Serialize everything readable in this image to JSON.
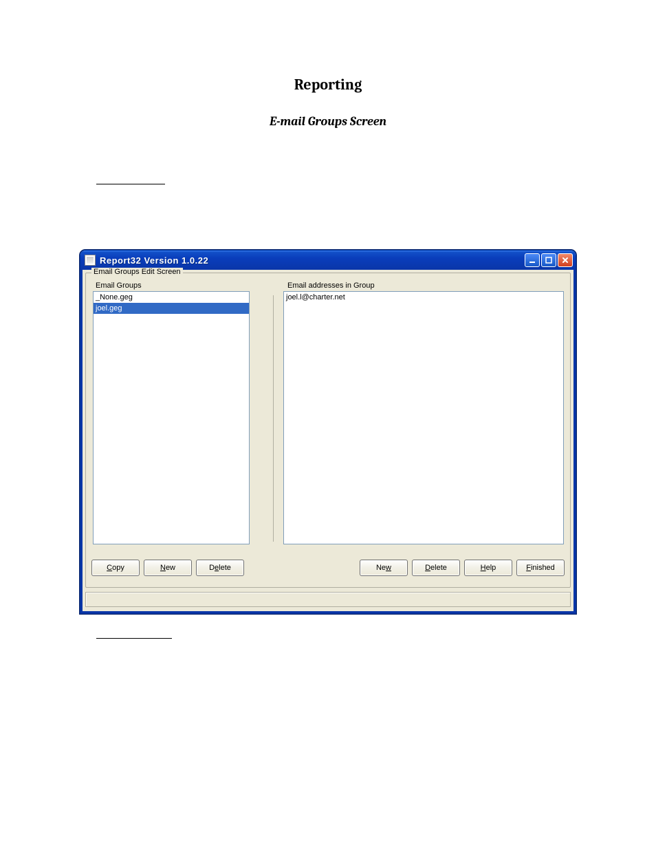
{
  "page": {
    "title": "Reporting",
    "subtitle": "E-mail Groups Screen"
  },
  "window": {
    "title": "Report32    Version 1.0.22",
    "groupbox_title": "Email Groups Edit Screen",
    "left": {
      "label": "Email Groups",
      "items": [
        {
          "text": "_None.geg",
          "selected": false
        },
        {
          "text": "joel.geg",
          "selected": true
        }
      ],
      "buttons": {
        "copy": {
          "accel": "C",
          "rest": "opy"
        },
        "new": {
          "accel": "N",
          "rest": "ew"
        },
        "delete": {
          "pre": "D",
          "accel": "e",
          "rest": "lete"
        }
      }
    },
    "right": {
      "label": "Email addresses in Group",
      "items": [
        {
          "text": "joel.l@charter.net",
          "selected": false
        }
      ],
      "buttons": {
        "new": {
          "pre": "Ne",
          "accel": "w",
          "rest": ""
        },
        "delete": {
          "accel": "D",
          "rest": "elete"
        },
        "help": {
          "accel": "H",
          "rest": "elp"
        },
        "finished": {
          "accel": "F",
          "rest": "inished"
        }
      }
    }
  }
}
